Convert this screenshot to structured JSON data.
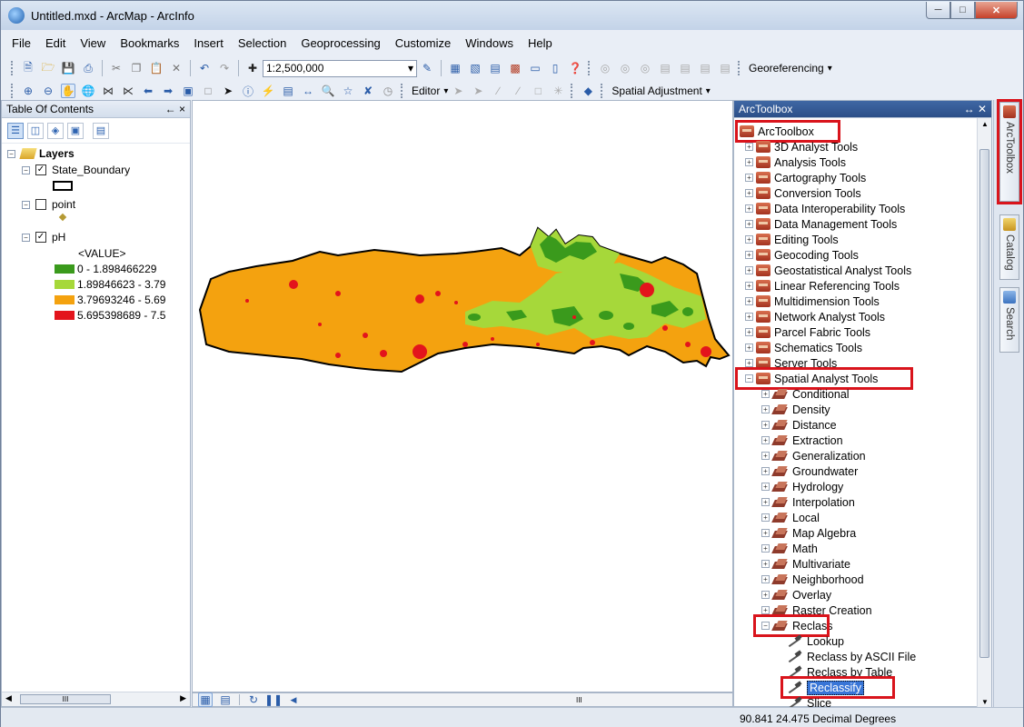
{
  "window": {
    "title": "Untitled.mxd - ArcMap - ArcInfo"
  },
  "menu": [
    "File",
    "Edit",
    "View",
    "Bookmarks",
    "Insert",
    "Selection",
    "Geoprocessing",
    "Customize",
    "Windows",
    "Help"
  ],
  "toolbar": {
    "scale": "1:2,500,000",
    "georeferencing": "Georeferencing",
    "editor": "Editor",
    "spatial_adjustment": "Spatial Adjustment"
  },
  "toc": {
    "title": "Table Of Contents",
    "pin": "← ×",
    "root": "Layers",
    "layers": [
      {
        "name": "State_Boundary",
        "checked": true
      },
      {
        "name": "point",
        "checked": false
      },
      {
        "name": "pH",
        "checked": true,
        "field": "<VALUE>",
        "classes": [
          {
            "label": "0 - 1.898466229",
            "color": "#3a9a1c"
          },
          {
            "label": "1.89846623 - 3.79",
            "color": "#a6d83a"
          },
          {
            "label": "3.79693246 - 5.69",
            "color": "#f4a20f"
          },
          {
            "label": "5.695398689 - 7.5",
            "color": "#e3141c"
          }
        ]
      }
    ]
  },
  "toolbox": {
    "title": "ArcToolbox",
    "root": "ArcToolbox",
    "tools": [
      "3D Analyst Tools",
      "Analysis Tools",
      "Cartography Tools",
      "Conversion Tools",
      "Data Interoperability Tools",
      "Data Management Tools",
      "Editing Tools",
      "Geocoding Tools",
      "Geostatistical Analyst Tools",
      "Linear Referencing Tools",
      "Multidimension Tools",
      "Network Analyst Tools",
      "Parcel Fabric Tools",
      "Schematics Tools",
      "Server Tools",
      "Spatial Analyst Tools"
    ],
    "spatial_sets": [
      "Conditional",
      "Density",
      "Distance",
      "Extraction",
      "Generalization",
      "Groundwater",
      "Hydrology",
      "Interpolation",
      "Local",
      "Map Algebra",
      "Math",
      "Multivariate",
      "Neighborhood",
      "Overlay",
      "Raster Creation",
      "Reclass"
    ],
    "reclass_tools": [
      "Lookup",
      "Reclass by ASCII File",
      "Reclass by Table",
      "Reclassify",
      "Slice"
    ]
  },
  "sidetabs": [
    "ArcToolbox",
    "Catalog",
    "Search"
  ],
  "status": {
    "coords": "90.841  24.475 Decimal Degrees"
  },
  "mapbar": {
    "hscroll": "III"
  }
}
